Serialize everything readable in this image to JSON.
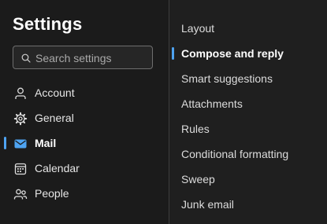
{
  "settings": {
    "title": "Settings",
    "search": {
      "placeholder": "Search settings",
      "icon": "search-icon"
    }
  },
  "nav": {
    "items": [
      {
        "label": "Account",
        "icon": "person-icon",
        "selected": false
      },
      {
        "label": "General",
        "icon": "gear-icon",
        "selected": false
      },
      {
        "label": "Mail",
        "icon": "mail-icon",
        "selected": true
      },
      {
        "label": "Calendar",
        "icon": "calendar-icon",
        "selected": false
      },
      {
        "label": "People",
        "icon": "people-icon",
        "selected": false
      }
    ]
  },
  "mail_options": {
    "items": [
      {
        "label": "Layout",
        "selected": false
      },
      {
        "label": "Compose and reply",
        "selected": true
      },
      {
        "label": "Smart suggestions",
        "selected": false
      },
      {
        "label": "Attachments",
        "selected": false
      },
      {
        "label": "Rules",
        "selected": false
      },
      {
        "label": "Conditional formatting",
        "selected": false
      },
      {
        "label": "Sweep",
        "selected": false
      },
      {
        "label": "Junk email",
        "selected": false
      }
    ]
  },
  "colors": {
    "accent": "#4ea3f1",
    "background": "#1b1b1b",
    "text": "#e6e6e6"
  }
}
